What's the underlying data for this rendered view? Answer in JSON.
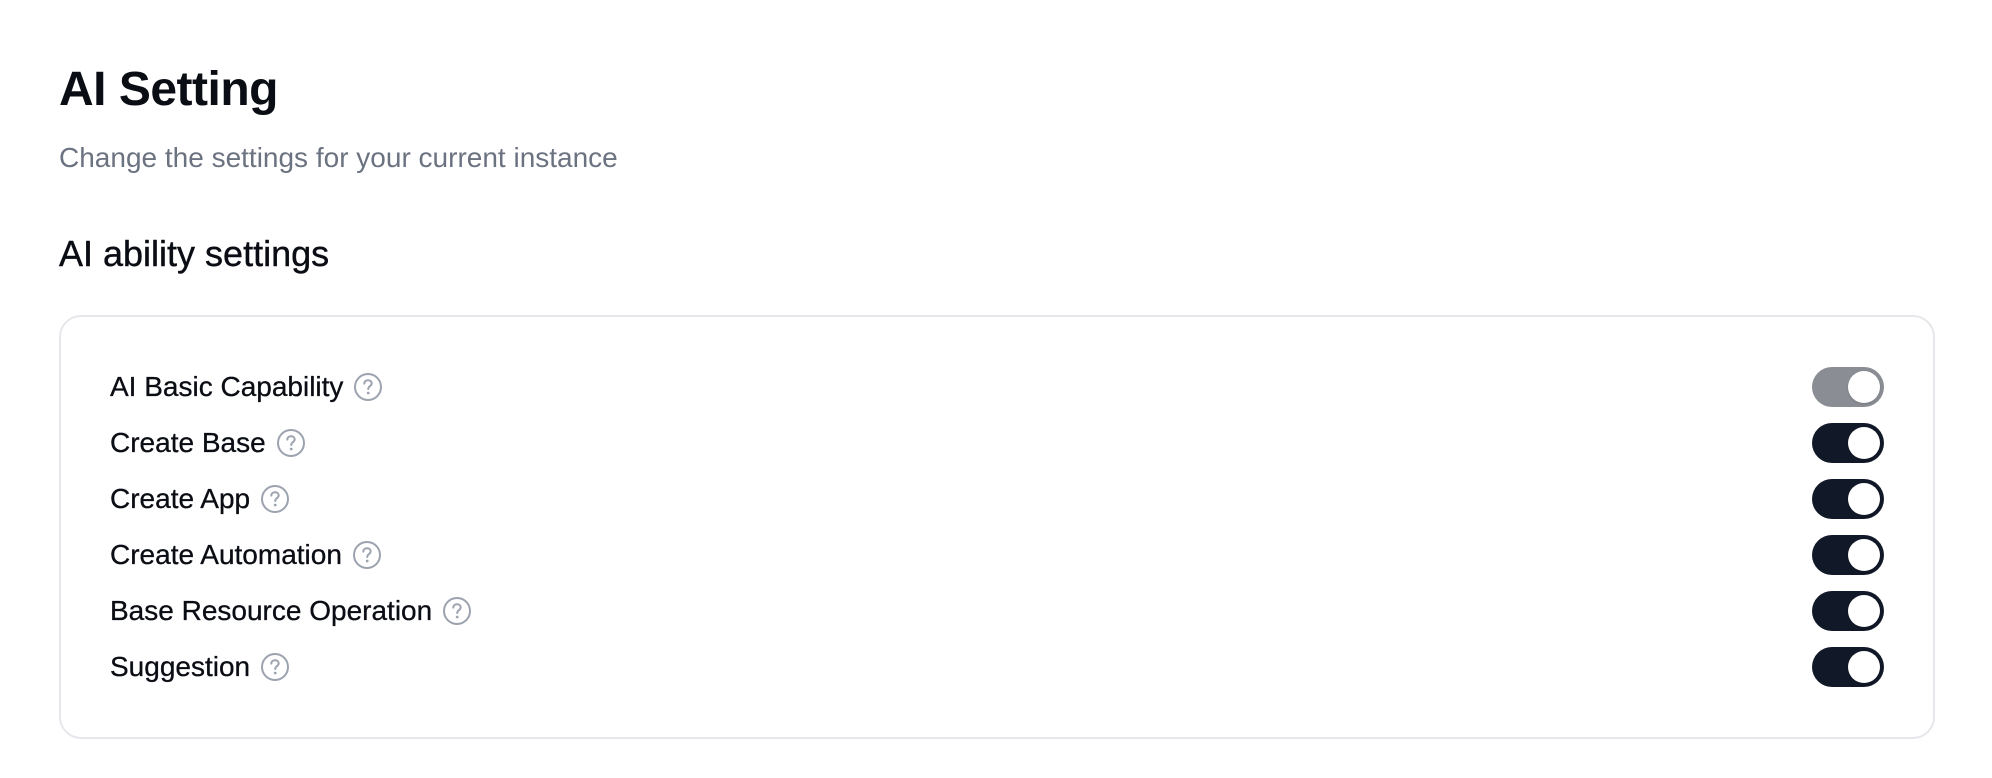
{
  "header": {
    "title": "AI Setting",
    "subtitle": "Change the settings for your current instance"
  },
  "section": {
    "title": "AI ability settings"
  },
  "settings": [
    {
      "label": "AI Basic Capability",
      "enabled": true,
      "disabled": true
    },
    {
      "label": "Create Base",
      "enabled": true,
      "disabled": false
    },
    {
      "label": "Create App",
      "enabled": true,
      "disabled": false
    },
    {
      "label": "Create Automation",
      "enabled": true,
      "disabled": false
    },
    {
      "label": "Base Resource Operation",
      "enabled": true,
      "disabled": false
    },
    {
      "label": "Suggestion",
      "enabled": true,
      "disabled": false
    }
  ],
  "icons": {
    "help": "question-circle-icon"
  },
  "colors": {
    "toggle_on": "#111827",
    "toggle_disabled": "#8a8d93",
    "card_border": "#e5e7eb",
    "subtitle": "#6b7280"
  }
}
